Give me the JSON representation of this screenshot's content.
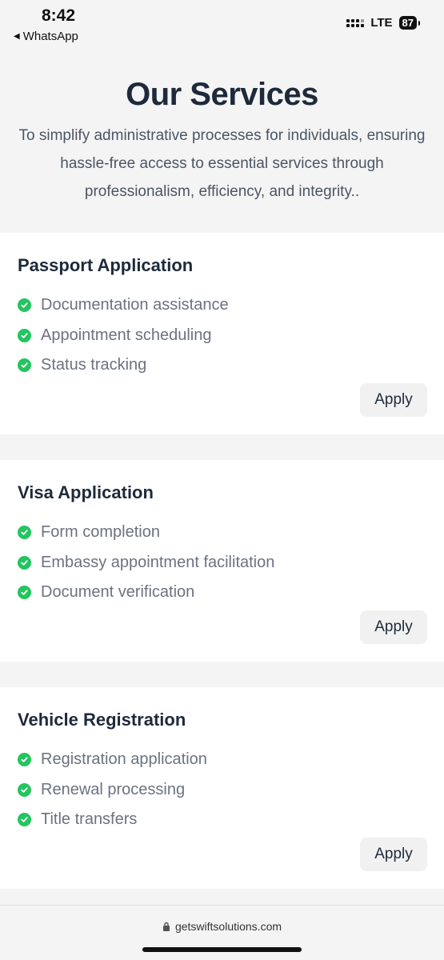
{
  "status_bar": {
    "time": "8:42",
    "back_app": "WhatsApp",
    "network": "LTE",
    "battery": "87"
  },
  "hero": {
    "title": "Our Services",
    "description": "To simplify administrative processes for individuals, ensuring hassle-free access to essential services through professionalism, efficiency, and integrity.."
  },
  "services": [
    {
      "title": "Passport Application",
      "features": [
        "Documentation assistance",
        "Appointment scheduling",
        "Status tracking"
      ],
      "button": "Apply"
    },
    {
      "title": "Visa Application",
      "features": [
        "Form completion",
        "Embassy appointment facilitation",
        "Document verification"
      ],
      "button": "Apply"
    },
    {
      "title": "Vehicle Registration",
      "features": [
        "Registration application",
        "Renewal processing",
        "Title transfers"
      ],
      "button": "Apply"
    }
  ],
  "browser": {
    "url": "getswiftsolutions.com"
  },
  "colors": {
    "check": "#22c55e",
    "title": "#1e2a3a",
    "feature_text": "#6b7280",
    "page_bg": "#f4f4f5"
  }
}
